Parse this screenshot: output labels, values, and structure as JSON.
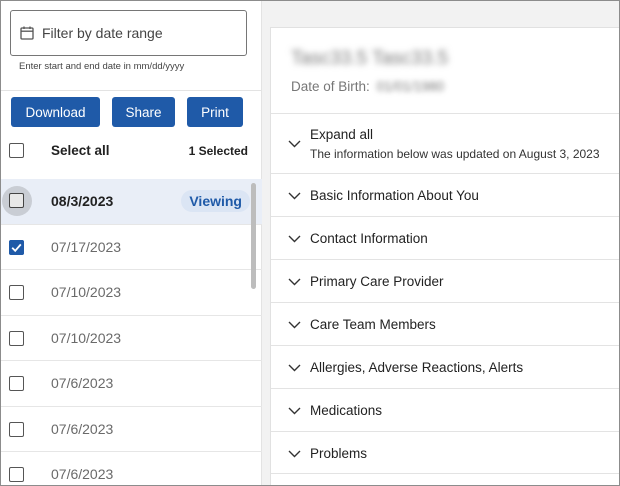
{
  "filter": {
    "icon": "calendar-icon",
    "placeholder": "Filter by date range",
    "hint": "Enter start and end date in mm/dd/yyyy"
  },
  "toolbar": {
    "download": "Download",
    "share": "Share",
    "print": "Print"
  },
  "select_all": {
    "label": "Select all",
    "count": "1 Selected"
  },
  "records": [
    {
      "date": "08/3/2023",
      "checked": false,
      "active": true,
      "badge": "Viewing"
    },
    {
      "date": "07/17/2023",
      "checked": true,
      "active": false
    },
    {
      "date": "07/10/2023",
      "checked": false,
      "active": false
    },
    {
      "date": "07/10/2023",
      "checked": false,
      "active": false
    },
    {
      "date": "07/6/2023",
      "checked": false,
      "active": false
    },
    {
      "date": "07/6/2023",
      "checked": false,
      "active": false
    },
    {
      "date": "07/6/2023",
      "checked": false,
      "active": false
    }
  ],
  "patient": {
    "name": "Tasc33.5 Tasc33.5",
    "dob_label": "Date of Birth:",
    "dob_value": "01/01/1980"
  },
  "expand": {
    "label": "Expand all",
    "updated": "The information below was updated on August 3, 2023"
  },
  "sections": [
    "Basic Information About You",
    "Contact Information",
    "Primary Care Provider",
    "Care Team Members",
    "Allergies, Adverse Reactions, Alerts",
    "Medications",
    "Problems"
  ],
  "colors": {
    "primary": "#1f5aa8",
    "active_row": "#e9eef7",
    "badge_bg": "#dbe5f4"
  }
}
